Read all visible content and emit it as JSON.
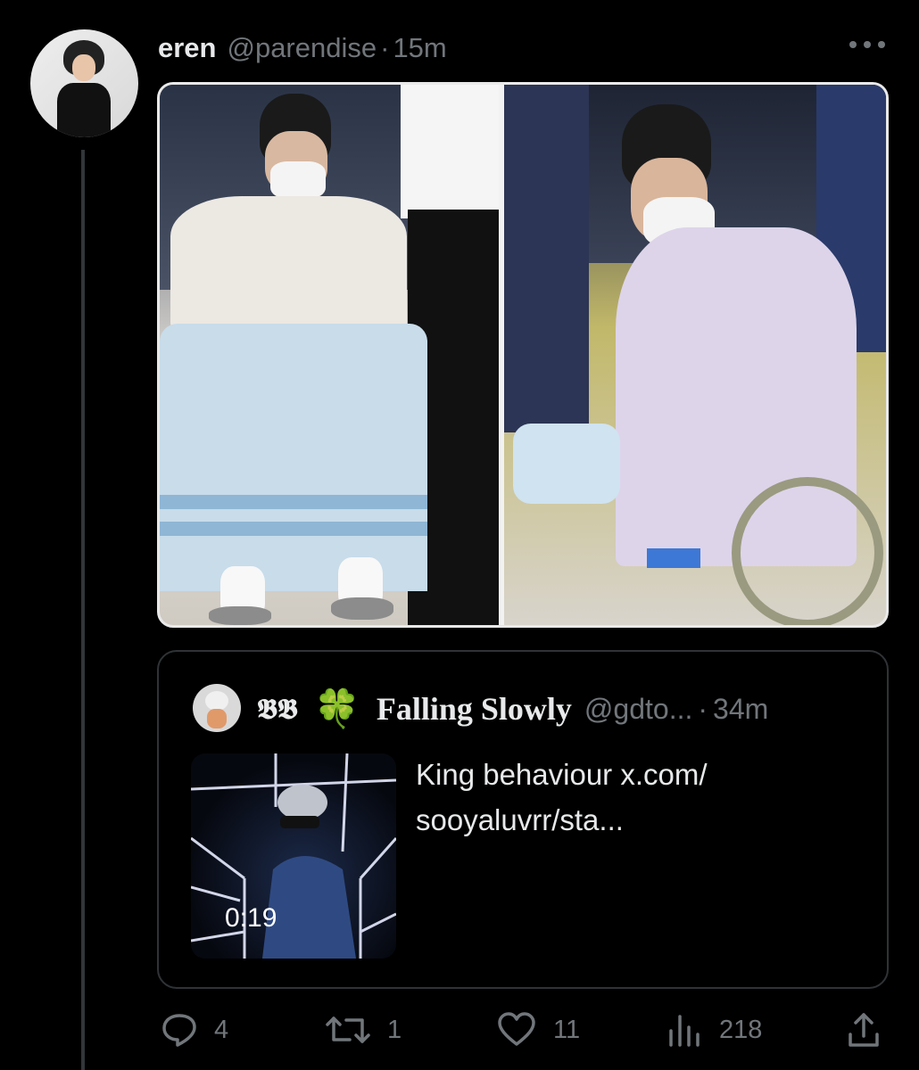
{
  "tweet": {
    "author_name": "eren",
    "author_handle": "@parendise",
    "separator": "·",
    "time": "15m"
  },
  "quote": {
    "badge_text": "𝕭𝕭",
    "clover": "🍀",
    "name": "Falling Slowly",
    "handle": "@gdto...",
    "separator": "·",
    "time": "34m",
    "text": "King behaviour x.com/ sooyaluvrr/sta...",
    "video_duration": "0:19"
  },
  "actions": {
    "replies": "4",
    "retweets": "1",
    "likes": "11",
    "views": "218"
  },
  "icons": {
    "more": "more-options-icon",
    "reply": "reply-icon",
    "retweet": "retweet-icon",
    "like": "heart-icon",
    "views": "views-icon",
    "share": "share-icon"
  }
}
